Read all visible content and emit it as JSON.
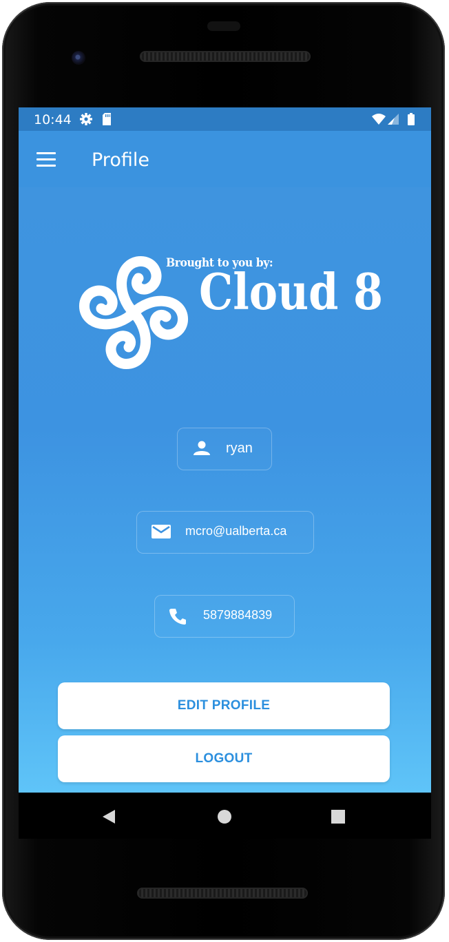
{
  "status_bar": {
    "time": "10:44",
    "icons": [
      "settings-icon",
      "sd-card-icon",
      "wifi-icon",
      "signal-icon",
      "battery-icon"
    ]
  },
  "app_bar": {
    "title": "Profile",
    "menu_icon": "menu-icon"
  },
  "logo": {
    "tagline": "Brought to you by:",
    "wordmark": "Cloud 8"
  },
  "profile": {
    "username": "ryan",
    "email": "mcro@ualberta.ca",
    "phone": "5879884839"
  },
  "actions": {
    "edit_label": "EDIT PROFILE",
    "logout_label": "LOGOUT"
  },
  "nav_bar": {
    "buttons": [
      "back-icon",
      "home-icon",
      "recents-icon"
    ]
  },
  "colors": {
    "status_bar": "#2d7cc3",
    "app_bar": "#3b93df",
    "gradient_top": "#3f94df",
    "gradient_bottom": "#5fc4f8",
    "button_text": "#2b8fde"
  }
}
